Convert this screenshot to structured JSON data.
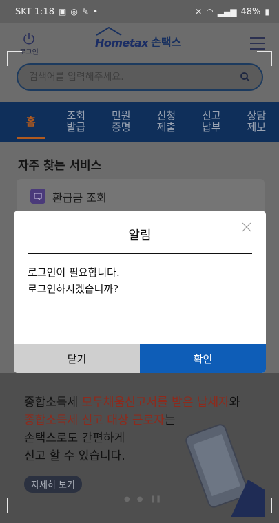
{
  "status_bar": {
    "carrier_time": "SKT 1:18",
    "battery": "48%"
  },
  "header": {
    "login_label": "로그인",
    "logo_mark": "Hometax",
    "logo_text": "손택스"
  },
  "search": {
    "placeholder": "검색어를 입력해주세요."
  },
  "nav": {
    "tabs": [
      {
        "label": "홈"
      },
      {
        "label": "조회\n발급"
      },
      {
        "label": "민원\n증명"
      },
      {
        "label": "신청\n제출"
      },
      {
        "label": "신고\n납부"
      },
      {
        "label": "상담\n제보"
      }
    ]
  },
  "main": {
    "section_title": "자주 찾는 서비스",
    "service_item": "환급금 조회"
  },
  "banner": {
    "line1_a": "종합소득세 ",
    "line1_b": "모두채움신고서를 받은 납세자",
    "line1_c": "와",
    "line2_a": "종합소득세 신고 대상 근로자",
    "line2_b": "는",
    "line3": "손택스로도 간편하게",
    "line4": "신고 할 수 있습니다.",
    "button": "자세히 보기"
  },
  "dialog": {
    "title": "알림",
    "message_line1": "로그인이 필요합니다.",
    "message_line2": "로그인하시겠습니까?",
    "close_button": "닫기",
    "ok_button": "확인"
  },
  "colors": {
    "nav_bg": "#0f2f5a",
    "active_tab": "#b05a1f",
    "ok_button": "#0e5db7",
    "highlight": "#8e2a1c"
  }
}
